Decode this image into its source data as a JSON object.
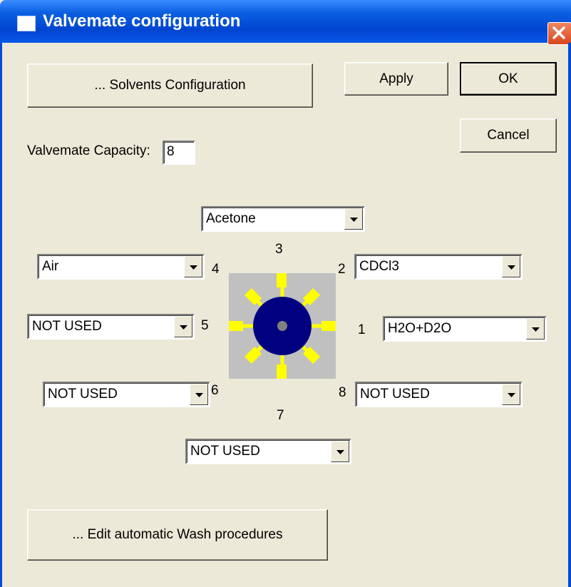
{
  "window": {
    "title": "Valvemate configuration",
    "close_icon": "close-icon"
  },
  "buttons": {
    "solvents": "... Solvents Configuration",
    "apply": "Apply",
    "ok": "OK",
    "cancel": "Cancel",
    "wash": "... Edit automatic Wash procedures"
  },
  "capacity": {
    "label": "Valvemate Capacity:",
    "value": "8"
  },
  "ports": {
    "p1": {
      "number": "1",
      "solvent": "H2O+D2O"
    },
    "p2": {
      "number": "2",
      "solvent": "CDCl3"
    },
    "p3": {
      "number": "3",
      "solvent": "Acetone"
    },
    "p4": {
      "number": "4",
      "solvent": "Air"
    },
    "p5": {
      "number": "5",
      "solvent": "NOT USED"
    },
    "p6": {
      "number": "6",
      "solvent": "NOT USED"
    },
    "p7": {
      "number": "7",
      "solvent": "NOT USED"
    },
    "p8": {
      "number": "8",
      "solvent": "NOT USED"
    }
  },
  "valve_colors": {
    "body": "#000080",
    "ports": "#FFFF00",
    "center": "#808080",
    "background": "#C0C0C0"
  }
}
